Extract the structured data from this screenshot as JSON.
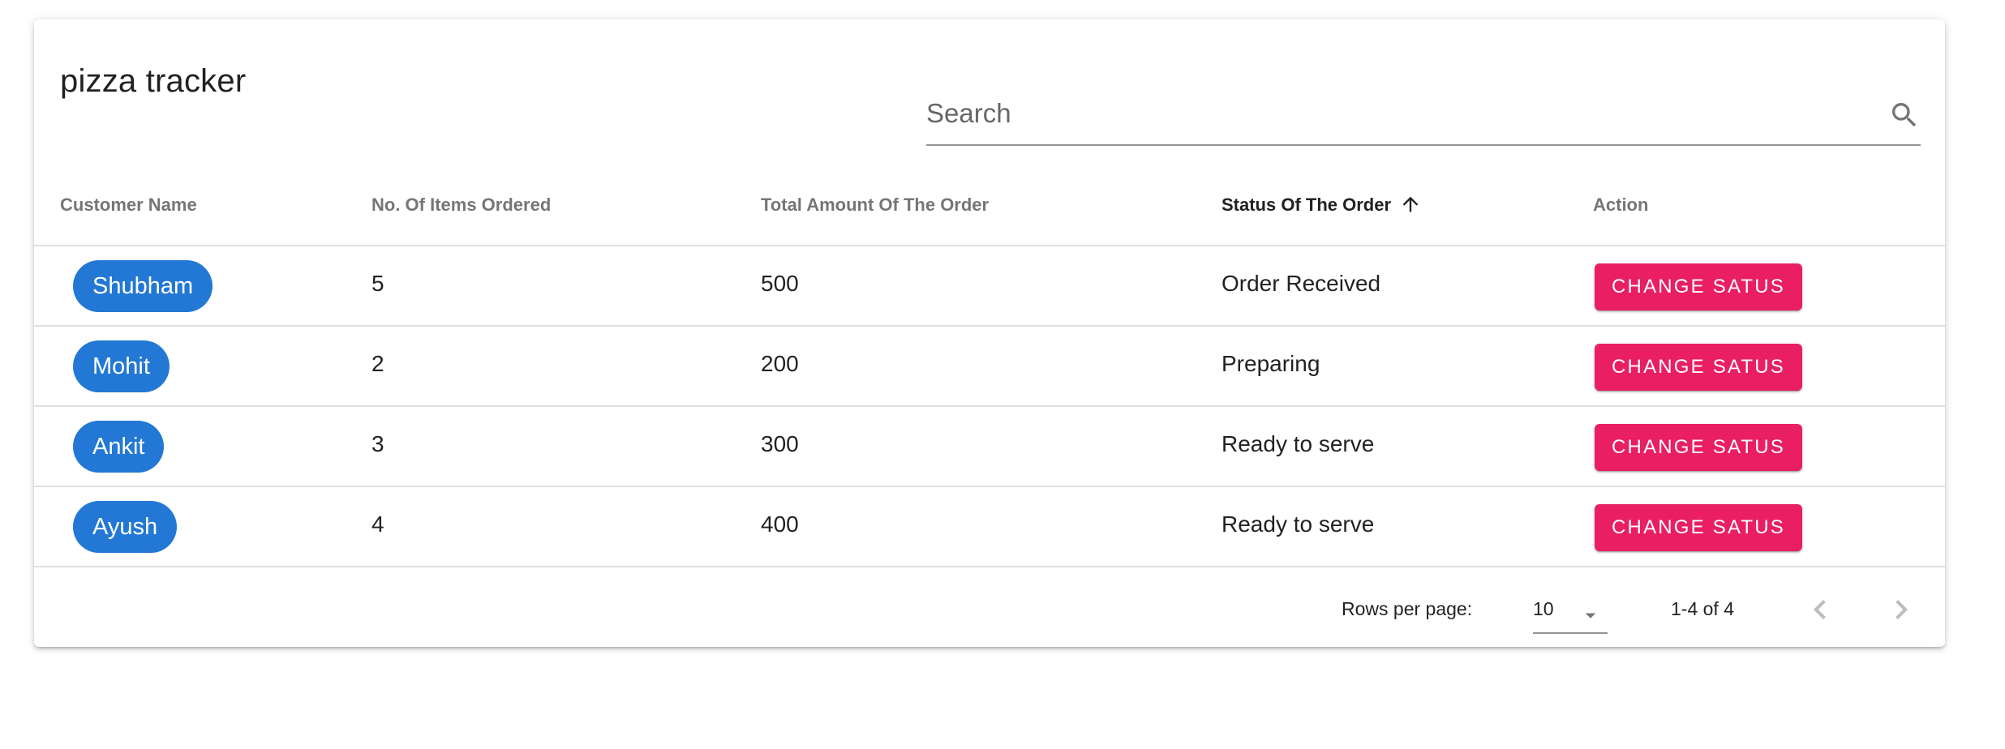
{
  "table": {
    "title": "pizza tracker",
    "search": {
      "placeholder": "Search",
      "value": ""
    },
    "columns": [
      {
        "label": "Customer Name"
      },
      {
        "label": "No. Of Items Ordered"
      },
      {
        "label": "Total Amount Of The Order"
      },
      {
        "label": "Status Of The Order",
        "sorted": "ascending"
      },
      {
        "label": "Action"
      }
    ],
    "rows": [
      {
        "customer": "Shubham",
        "items": "5",
        "amount": "500",
        "status": "Order Received",
        "action": "CHANGE SATUS"
      },
      {
        "customer": "Mohit",
        "items": "2",
        "amount": "200",
        "status": "Preparing",
        "action": "CHANGE SATUS"
      },
      {
        "customer": "Ankit",
        "items": "3",
        "amount": "300",
        "status": "Ready to serve",
        "action": "CHANGE SATUS"
      },
      {
        "customer": "Ayush",
        "items": "4",
        "amount": "400",
        "status": "Ready to serve",
        "action": "CHANGE SATUS"
      }
    ],
    "pagination": {
      "rows_per_page_label": "Rows per page:",
      "rows_per_page": "10",
      "range": "1-4 of 4"
    }
  },
  "icons": {
    "search": "search-icon",
    "sort": "arrow-upward-icon",
    "dropdown": "arrow-drop-down-icon",
    "prev": "chevron-left-icon",
    "next": "chevron-right-icon"
  },
  "colors": {
    "chip": "#2278d4",
    "action_button": "#e91e63"
  }
}
